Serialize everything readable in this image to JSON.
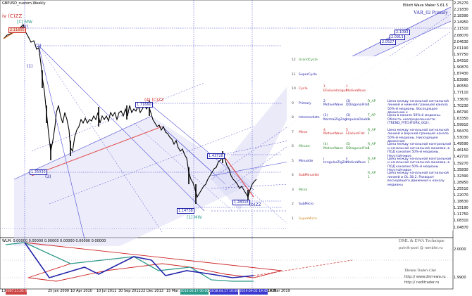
{
  "window": {
    "symbol_label": "GBPUSD_custom,Weekly",
    "indicator_title": "Elliott Wave Maker 5.61.5",
    "variant_title": "VAR_02 Primary",
    "indicator_window_label": "WLM: 0.00000 0.00000 0.00000 0.00000 0.00000 0.00000"
  },
  "price_axis": {
    "ticks": [
      "2.25270",
      "2.21830",
      "2.18390",
      "2.14950",
      "2.11510",
      "2.08070",
      "2.04630",
      "2.01190",
      "1.97750",
      "1.94310",
      "1.90870",
      "1.87430",
      "1.83990",
      "1.80550",
      "1.77110",
      "1.73670",
      "1.70230",
      "1.66790",
      "1.63350",
      "1.59910",
      "1.56470",
      "1.53030",
      "1.49590",
      "1.46150",
      "1.42710",
      "1.39270",
      "1.35830",
      "1.32390",
      "1.28950",
      "1.25510",
      "1.22070",
      "1.18630",
      "1.15190",
      "1.11750",
      "1.08310",
      "1.04870",
      "2.0000",
      "1.9900"
    ]
  },
  "time_axis": {
    "ticks": [
      "13 Aug 2007",
      "25 Jan 2009",
      "10 Apr 2010",
      "10 Jul 2011",
      "30 Sep 2012",
      "22 Dec 2013",
      "15 Mar 2015",
      "22 May 2016",
      "10 Aug 2017",
      "14 Nov 2018",
      "14 Mar 2019"
    ],
    "highlight_1": "2007.11.05 00:00",
    "highlight_2": "2016.06.17 00:00",
    "highlight_3": "2018.04.17 10:00",
    "highlight_4": "2019.09.02 19:45"
  },
  "wave_labels": {
    "top_degree": "iv (C)ZZ",
    "top_sub": "[C] MW",
    "top_box": "2.11850",
    "w1": "(1)",
    "w2": "(2)",
    "w3": "[3]",
    "mid_high": "(4) (C)ZZ",
    "mid_high_box": "1.71660",
    "left_low_box": "1.35030",
    "left_low_tag": "(3)",
    "bottom_box": "1.14738",
    "bottom_tag": "[1] MW",
    "right_box": "1.43728",
    "right_low_box": "1.28018",
    "right_low_tag": "(b)ZZ",
    "top_right_box_1": "2.1093",
    "top_right_box_2": "2.0913",
    "top_right_box_3": "2.0527"
  },
  "panel": {
    "rows": [
      {
        "n": "12",
        "level": "GrandCycle",
        "c1": "",
        "c2": "",
        "c3": "",
        "desc": "",
        "color": "#2e8b2e"
      },
      {
        "n": "11",
        "level": "SuperCycle",
        "c1": "",
        "c2": "",
        "c3": "",
        "desc": "",
        "color": "#2222aa"
      },
      {
        "n": "10",
        "level": "Cycle",
        "c1": "1\nEFailureIrregul",
        "c2": "1\nMotiveWave",
        "c3": "",
        "desc": "",
        "color": "#cc2222"
      },
      {
        "n": "9",
        "level": "Primary",
        "c1": "2\nMotiveWave",
        "c2": "(3)\nDDiagonalFlat",
        "c3": "R_AP\n1",
        "desc": "Цена между начальной сигнальной линией и нижней границей канала 50%-й медианы. Восходящее движение к",
        "color": "#2222aa"
      },
      {
        "n": "8",
        "level": "Intermediate",
        "c1": "(2)\nNormalZigZag",
        "c2": "(3)\nImpulseDouble",
        "c3": "T_AP\n1",
        "desc": "Цена в канале 50%-й медианы. Область неопределенности (TREND_PITCHFORK_002).",
        "color": "#2222aa"
      },
      {
        "n": "7",
        "level": "Minor",
        "c1": "4\nMotiveWave",
        "c2": "5\nEFailureFlat",
        "c3": "R_AP\n1",
        "desc": "Цена между начальной сигнальной линией и верхней границей канала 50%-й медианы. Нисходящее движение",
        "color": "#cc2222"
      },
      {
        "n": "6",
        "level": "Minute",
        "c1": "(4)\nMotiveWave",
        "c2": "(5)\nDDiagonalFlat",
        "c3": "R_AP\n1",
        "desc": "Цена между начальной контрольной и начальной сигнальной линиями, в ПОД каналом 50%-й медианы. Неустойчивое",
        "color": "#2e8b2e"
      },
      {
        "n": "5",
        "level": "Minuette",
        "c1": "i\nIrregularZigZa",
        "c2": "ii\nMotiveWave",
        "c3": "R_AP\n1",
        "desc": "Цена между начальной контрольной и начальной сигнальной линиями, в ПОД каналом 50%-й медианы. Неустойчивое",
        "color": "#2222aa"
      },
      {
        "n": "4",
        "level": "SubMinuette",
        "c1": "",
        "c2": "",
        "c3": "R_AP\n1",
        "desc": "Цена между начальной сигнальной линией и ОL 38.2. Разворот восходящего движения к каналу медианы",
        "color": "#cc2222"
      },
      {
        "n": "3",
        "level": "Micro",
        "c1": "",
        "c2": "",
        "c3": "",
        "desc": "",
        "color": "#2e8b2e"
      },
      {
        "n": "2",
        "level": "SubMicro",
        "c1": "",
        "c2": "",
        "c3": "",
        "desc": "",
        "color": "#2222aa"
      },
      {
        "n": "1",
        "level": "SuperMicro",
        "c1": "",
        "c2": "",
        "c3": "",
        "desc": "",
        "color": "#cc8822"
      }
    ]
  },
  "watermarks": {
    "wm1": "DML & EWA Technique",
    "wm2": "putnik-post @ rambler.ru",
    "wm3": "Tibetans  Traders  Club",
    "wm4": "http:// www.dml-ewa.ru",
    "wm5": "http:// neditrader.ru"
  },
  "colors": {
    "candles": "#000000",
    "channel_fill": "#d8d8f4",
    "channel_line": "#3a3ad0",
    "median_red": "#e04040",
    "wave_red": "#cc2222",
    "wave_blue": "#2222aa",
    "wave_teal": "#2a9a8a"
  }
}
